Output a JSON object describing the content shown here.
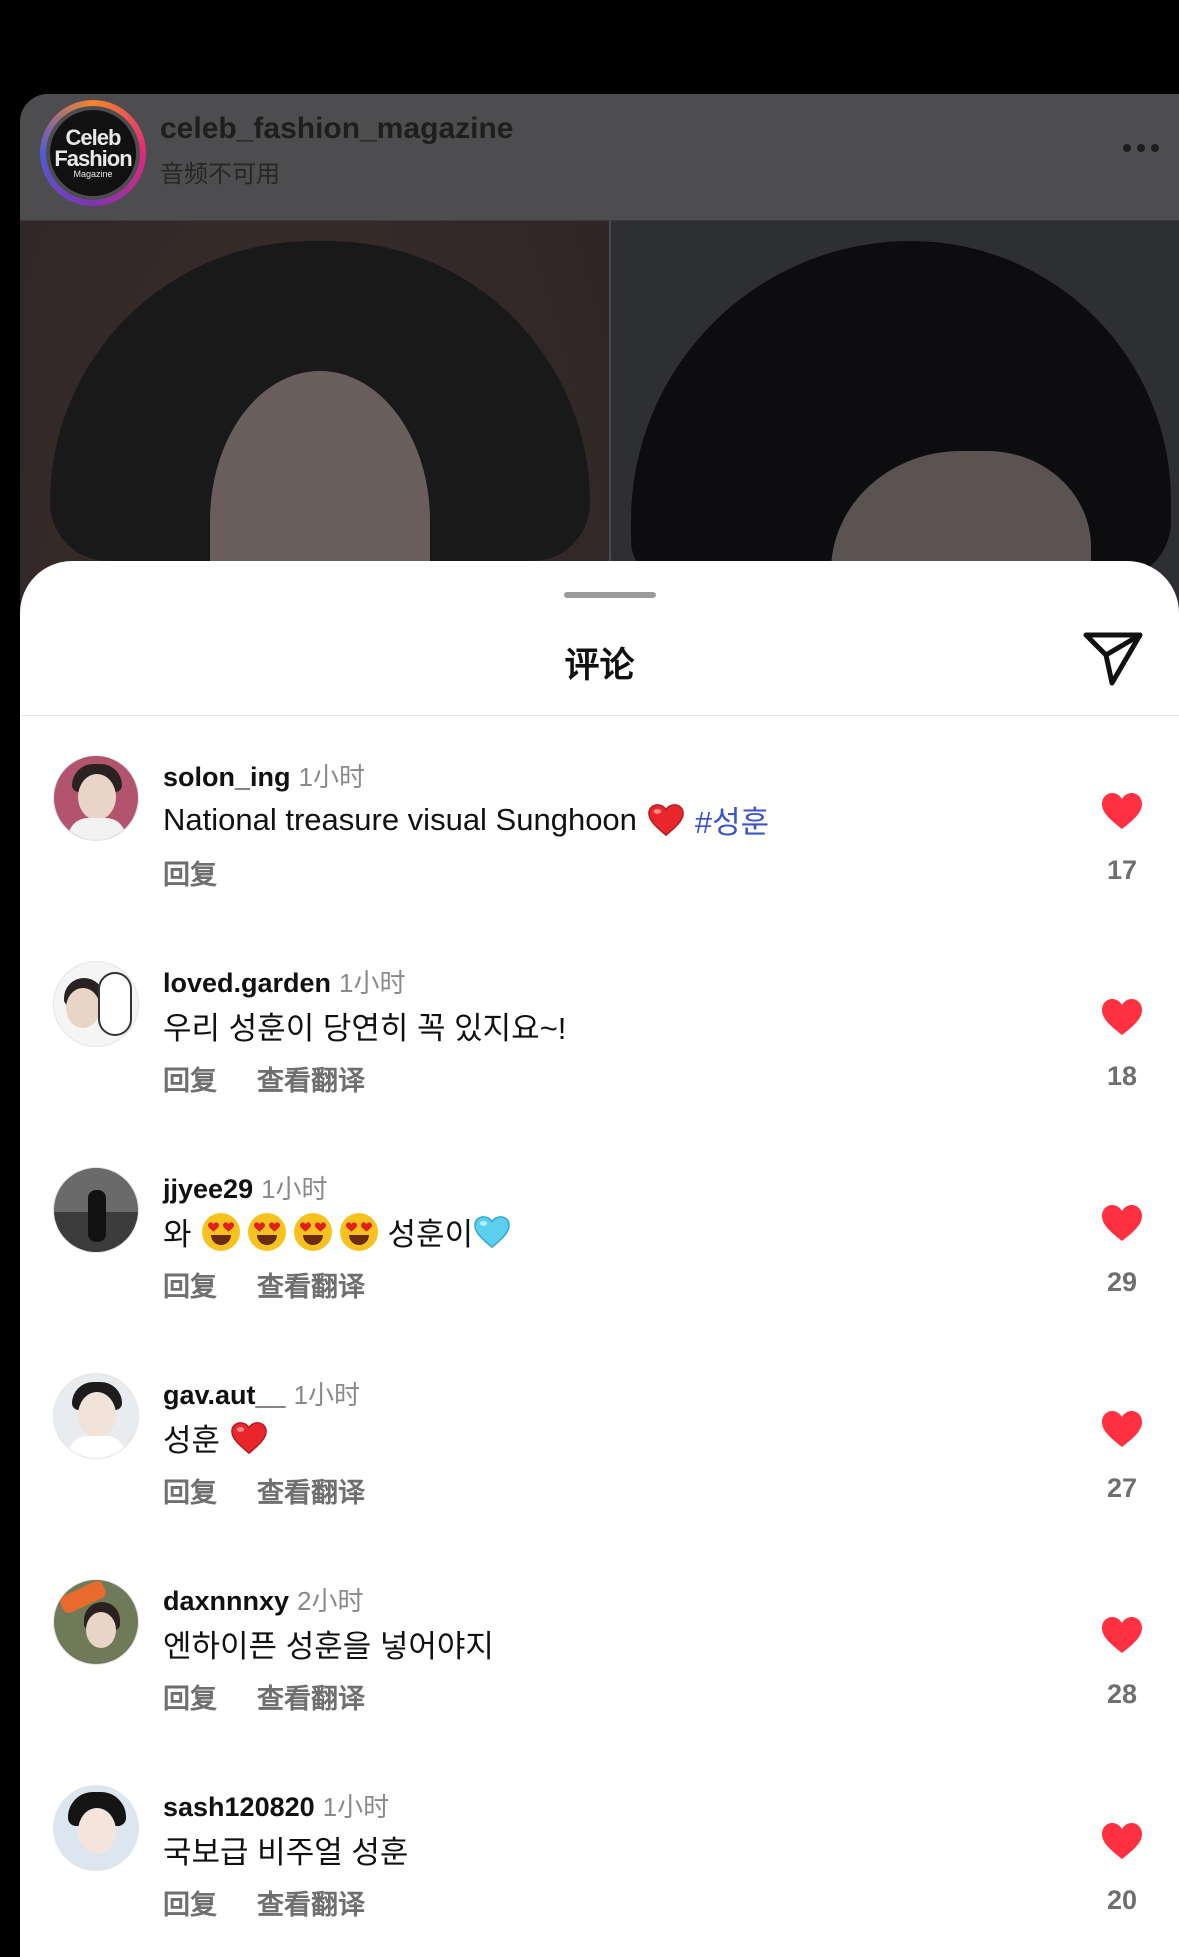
{
  "post": {
    "account_name": "celeb_fashion_magazine",
    "audio_status": "音频不可用",
    "logo": {
      "line1": "Celeb",
      "line2": "Fashion",
      "line3": "Magazine"
    },
    "more_icon": "more-horizontal-icon"
  },
  "sheet": {
    "title": "评论",
    "send_icon": "send-icon"
  },
  "colors": {
    "heart": "#ff3040",
    "hashtag": "#3b54c7",
    "muted_text": "#6f6f6f",
    "time_text": "#8a8a8a"
  },
  "comments": [
    {
      "username": "solon_ing",
      "time": "1小时",
      "text": "National treasure visual Sunghoon",
      "emoji": "red-heart",
      "hashtag": "#성훈",
      "reply": "回复",
      "translate": "",
      "likes": "17"
    },
    {
      "username": "loved.garden",
      "time": "1小时",
      "text": "우리 성훈이 당연히 꼭 있지요~!",
      "reply": "回复",
      "translate": "查看翻译",
      "likes": "18"
    },
    {
      "username": "jjyee29",
      "time": "1小时",
      "text_before": "와",
      "emoji": "heart-eyes x4",
      "text_after": "성훈이",
      "emoji_after": "light-blue-heart",
      "reply": "回复",
      "translate": "查看翻译",
      "likes": "29"
    },
    {
      "username": "gav.aut__",
      "time": "1小时",
      "text": "성훈",
      "emoji": "red-heart",
      "reply": "回复",
      "translate": "查看翻译",
      "likes": "27"
    },
    {
      "username": "daxnnnxy",
      "time": "2小时",
      "text": "엔하이픈 성훈을 넣어야지",
      "reply": "回复",
      "translate": "查看翻译",
      "likes": "28"
    },
    {
      "username": "sash120820",
      "time": "1小时",
      "text": "국보급 비주얼 성훈",
      "reply": "回复",
      "translate": "查看翻译",
      "likes": "20"
    }
  ]
}
